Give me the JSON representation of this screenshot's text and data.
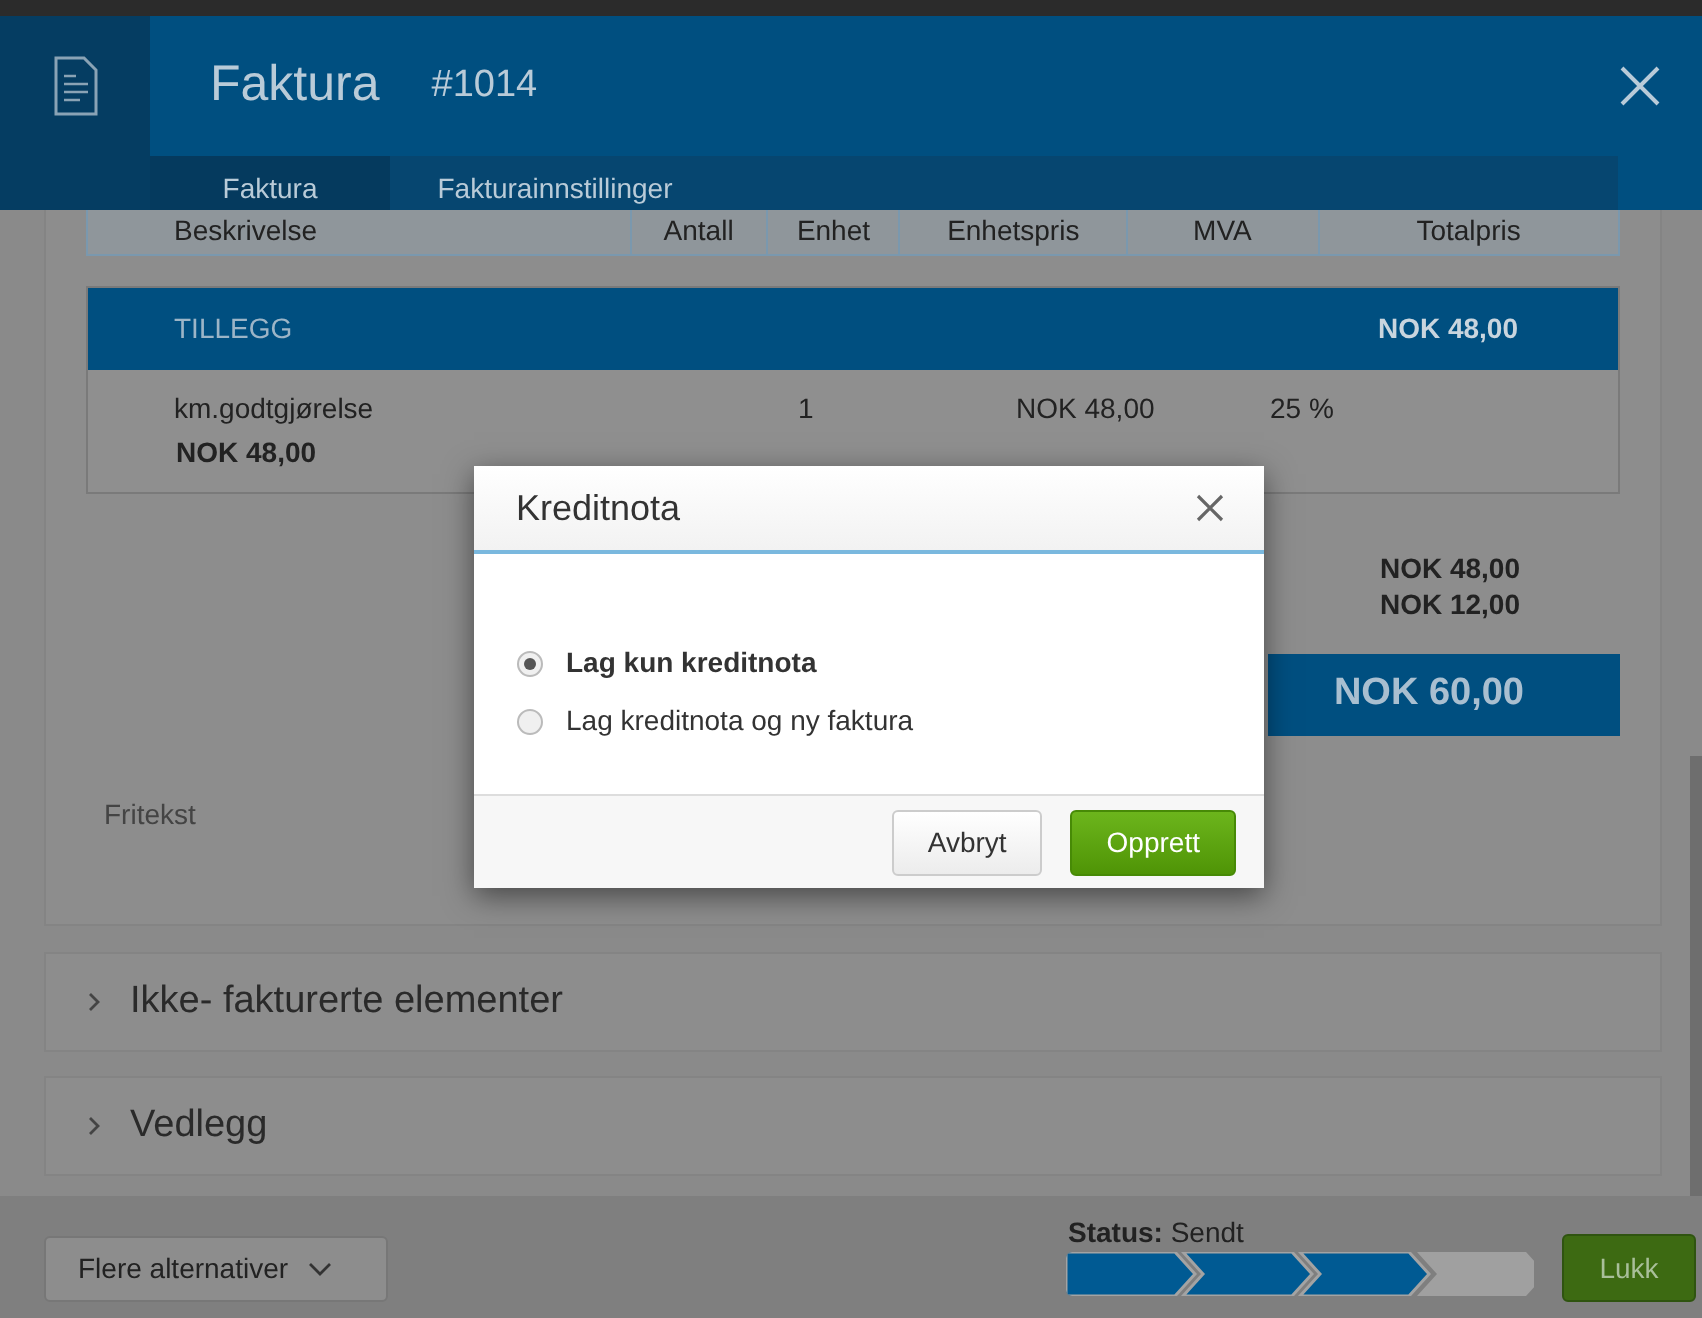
{
  "header": {
    "title": "Faktura",
    "number": "#1014",
    "tabs": [
      {
        "label": "Faktura",
        "selected": true
      },
      {
        "label": "Fakturainnstillinger",
        "selected": false
      }
    ]
  },
  "table": {
    "columns": [
      "Beskrivelse",
      "Antall",
      "Enhet",
      "Enhetspris",
      "MVA",
      "Totalpris"
    ],
    "sections": [
      {
        "title": "TILLEGG",
        "total": "NOK 48,00",
        "rows": [
          {
            "description": "km.godtgjørelse",
            "quantity": "1",
            "unit_price": "NOK 48,00",
            "vat": "25 %",
            "subtotal": "NOK 48,00"
          }
        ]
      }
    ]
  },
  "totals": [
    "NOK 48,00",
    "NOK 12,00"
  ],
  "grand_total": "NOK 60,00",
  "free_text_label": "Fritekst",
  "accordions": [
    {
      "label": "Ikke- fakturerte elementer",
      "expanded": false
    },
    {
      "label": "Vedlegg",
      "expanded": false
    }
  ],
  "footer": {
    "more_button": "Flere alternativer",
    "status_label": "Status:",
    "status_value": "Sendt",
    "steps": [
      {
        "done": true
      },
      {
        "done": true
      },
      {
        "done": true
      },
      {
        "done": false
      }
    ],
    "close_button": "Lukk"
  },
  "modal": {
    "title": "Kreditnota",
    "options": [
      {
        "label": "Lag kun kreditnota",
        "selected": true
      },
      {
        "label": "Lag kreditnota og ny faktura",
        "selected": false
      }
    ],
    "buttons": [
      {
        "label": "Avbryt",
        "kind": "secondary"
      },
      {
        "label": "Opprett",
        "kind": "primary"
      }
    ]
  }
}
